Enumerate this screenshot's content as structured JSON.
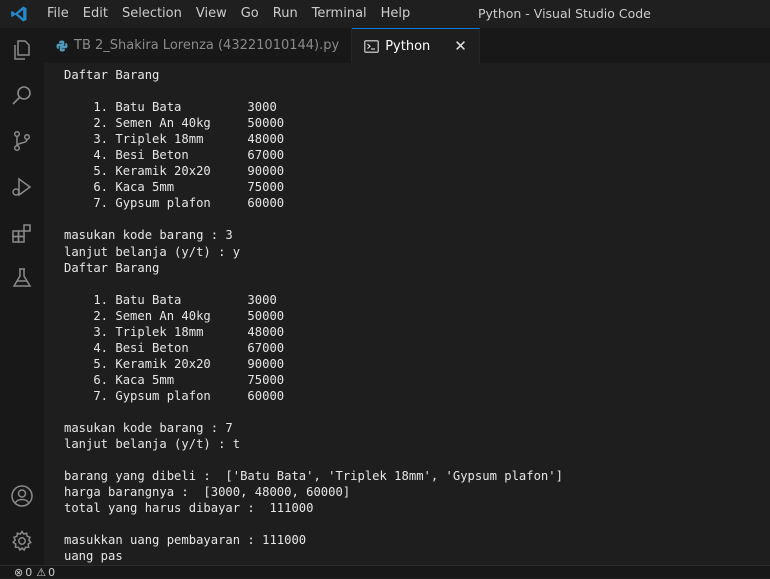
{
  "titlebar": {
    "menu": [
      "File",
      "Edit",
      "Selection",
      "View",
      "Go",
      "Run",
      "Terminal",
      "Help"
    ],
    "window_title": "Python - Visual Studio Code"
  },
  "activity_bar": {
    "icons": [
      "explorer-icon",
      "search-icon",
      "source-control-icon",
      "run-debug-icon",
      "extensions-icon",
      "testing-icon",
      "account-icon",
      "settings-gear-icon"
    ]
  },
  "tabs": [
    {
      "label": "TB 2_Shakira Lorenza (43221010144).py",
      "icon": "python-file-icon",
      "active": false
    },
    {
      "label": "Python",
      "icon": "terminal-icon",
      "active": true
    }
  ],
  "terminal": {
    "lines": [
      "Daftar Barang",
      "",
      "    1. Batu Bata         3000",
      "    2. Semen An 40kg     50000",
      "    3. Triplek 18mm      48000",
      "    4. Besi Beton        67000",
      "    5. Keramik 20x20     90000",
      "    6. Kaca 5mm          75000",
      "    7. Gypsum plafon     60000",
      "",
      "masukan kode barang : 3",
      "lanjut belanja (y/t) : y",
      "Daftar Barang",
      "",
      "    1. Batu Bata         3000",
      "    2. Semen An 40kg     50000",
      "    3. Triplek 18mm      48000",
      "    4. Besi Beton        67000",
      "    5. Keramik 20x20     90000",
      "    6. Kaca 5mm          75000",
      "    7. Gypsum plafon     60000",
      "",
      "masukan kode barang : 7",
      "lanjut belanja (y/t) : t",
      "",
      "barang yang dibeli :  ['Batu Bata', 'Triplek 18mm', 'Gypsum plafon']",
      "harga barangnya :  [3000, 48000, 60000]",
      "total yang harus dibayar :  111000",
      "",
      "masukkan uang pembayaran : 111000",
      "uang pas"
    ]
  },
  "statusbar": {
    "errors": "0",
    "warnings": "0"
  },
  "colors": {
    "accent": "#0078d4",
    "background": "#1e1e1e",
    "sidebar": "#181818"
  }
}
